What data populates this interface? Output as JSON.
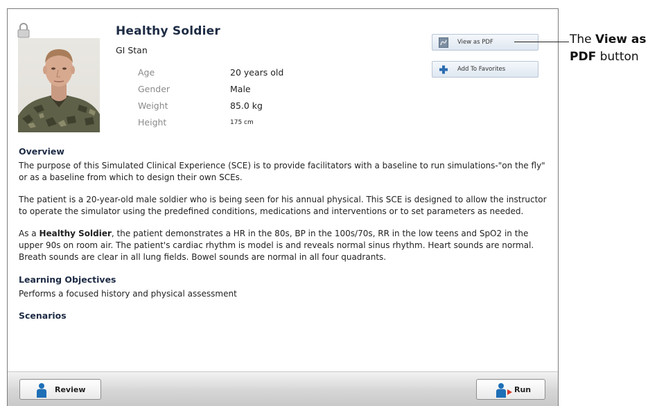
{
  "scenario": {
    "title": "Healthy Soldier",
    "patient_name": "GI Stan",
    "details": [
      {
        "label": "Age",
        "value": "20 years old"
      },
      {
        "label": "Gender",
        "value": "Male"
      },
      {
        "label": "Weight",
        "value": "85.0 kg"
      },
      {
        "label": "Height",
        "value": "175 cm"
      }
    ]
  },
  "actions": {
    "view_pdf_label": "View as PDF",
    "add_favorites_label": "Add To Favorites"
  },
  "overview": {
    "heading": "Overview",
    "para1": "The purpose of this Simulated Clinical Experience (SCE) is to provide facilitators with a baseline to run simulations-\"on the fly\" or as a baseline from which to design their own SCEs.",
    "para2": "The patient is a 20-year-old male soldier who is being seen for his annual physical. This SCE is designed to allow the instructor to operate the simulator using the predefined conditions, medications and interventions or to set parameters as needed.",
    "para3_prefix": "As a ",
    "para3_bold": "Healthy Soldier",
    "para3_rest": ", the patient demonstrates a HR in the 80s, BP in the 100s/70s, RR in the low teens and SpO2 in the upper 90s on room air. The patient's cardiac rhythm is model is and reveals normal sinus rhythm. Heart sounds are normal. Breath sounds are clear in all lung fields. Bowel sounds are normal in all four quadrants."
  },
  "learning_objectives": {
    "heading": "Learning Objectives",
    "text": "Performs a focused history and physical assessment"
  },
  "scenarios": {
    "heading": "Scenarios"
  },
  "footer": {
    "review_label": "Review",
    "run_label": "Run"
  },
  "callout": {
    "prefix": "The ",
    "bold": "View as PDF",
    "suffix": " button"
  },
  "colors": {
    "title": "#1d2b44",
    "label_gray": "#8a8a8a",
    "button_blue": "#dfe7f1",
    "person_icon_blue": "#1e6fb6",
    "run_arrow_red": "#d23a2a"
  }
}
